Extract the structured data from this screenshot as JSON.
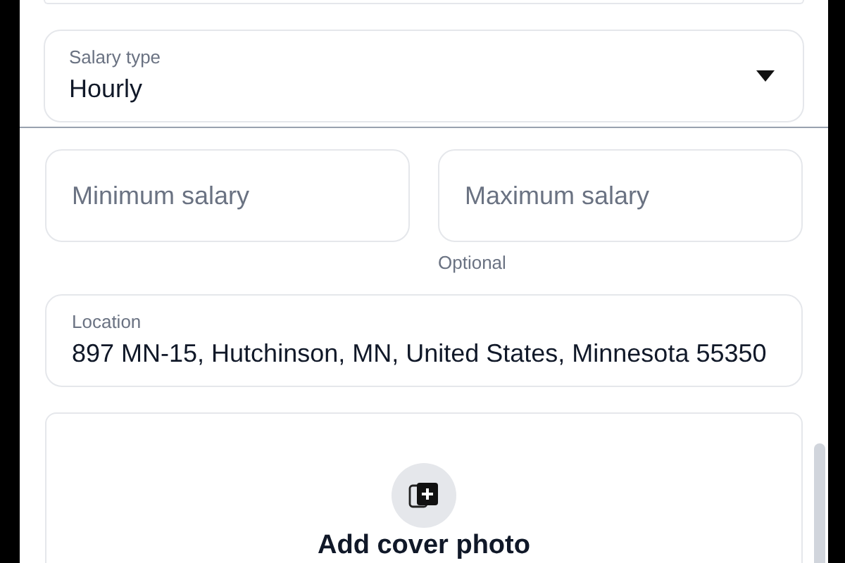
{
  "salary_type": {
    "label": "Salary type",
    "value": "Hourly"
  },
  "salary_fields": [
    {
      "placeholder": "Minimum salary"
    },
    {
      "placeholder": "Maximum salary",
      "helper": "Optional"
    }
  ],
  "location": {
    "label": "Location",
    "value": "897 MN-15, Hutchinson, MN, United States, Minnesota 55350"
  },
  "cover_photo": {
    "label": "Add cover photo"
  }
}
